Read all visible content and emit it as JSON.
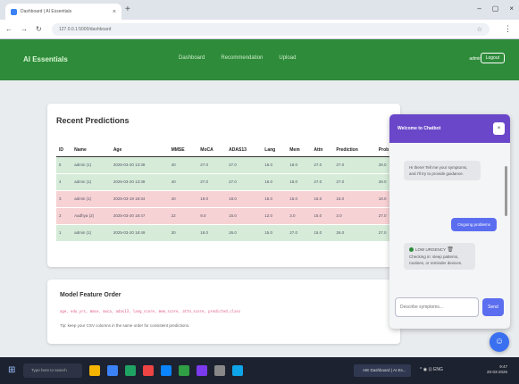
{
  "browser": {
    "tab_title": "Dashboard | AI Essentials",
    "url": "127.0.0.1:5000/dashboard",
    "close_glyph": "×",
    "new_tab_glyph": "+",
    "win_controls": [
      "–",
      "▢",
      "×"
    ],
    "nav_glyphs": [
      "←",
      "→",
      "↻"
    ],
    "star_glyph": "☆",
    "menu_glyph": "⋮"
  },
  "app": {
    "brand": "AI Essentials",
    "menu": [
      "Dashboard",
      "Recommendation",
      "Upload"
    ],
    "user": "admin",
    "logout": "Logout",
    "accent": "#2e8b3a"
  },
  "predictions": {
    "title": "Recent Predictions",
    "columns": [
      "ID",
      "Name",
      "Age",
      "MMSE",
      "MoCA",
      "ADAS13",
      "Lang",
      "Mem",
      "Attn",
      "Prediction",
      "Prob"
    ],
    "rows": [
      {
        "status": "green",
        "cells": [
          "5",
          "admin (1)",
          "2025-03-20 13:38",
          "40",
          "27.0",
          "27.0",
          "16.0",
          "18.0",
          "27.0",
          "27.0",
          "28.0"
        ]
      },
      {
        "status": "green",
        "cells": [
          "4",
          "admin (1)",
          "2025-03-20 13:38",
          "40",
          "27.0",
          "27.0",
          "16.0",
          "18.0",
          "27.0",
          "27.0",
          "28.0"
        ]
      },
      {
        "status": "red",
        "cells": [
          "3",
          "admin (1)",
          "2025-03-19 18:34",
          "40",
          "19.0",
          "18.0",
          "15.0",
          "15.0",
          "16.0",
          "15.0",
          "18.0"
        ]
      },
      {
        "status": "red",
        "cells": [
          "2",
          "Aadhya (2)",
          "2025-03-20 18:47",
          "22",
          "9.0",
          "15.0",
          "12.0",
          "3.0",
          "15.0",
          "3.0",
          "27.0"
        ]
      },
      {
        "status": "green",
        "cells": [
          "1",
          "admin (1)",
          "2025-03-20 18:49",
          "30",
          "18.0",
          "26.0",
          "15.0",
          "27.0",
          "15.0",
          "26.0",
          "27.0"
        ]
      }
    ]
  },
  "features": {
    "title": "Model Feature Order",
    "columns_text": "age, edu_yrs, mmse, moca, adas13, lang_score, mem_score, attn_score, predicted_class",
    "tip": "Tip: keep your CSV columns in the same order for consistent predictions."
  },
  "chat": {
    "title": "Welcome to Chatbot",
    "close": "×",
    "bot_msg_1": "Hi there! Tell me your symptoms, and I'll try to provide guidance.",
    "user_msg": "Ongoing problems",
    "bot_msg_2_label": "LOW URGENCY",
    "bot_msg_2_text": "Checking in: sleep patterns, routines, or reminder devices.",
    "trash_icon": "🗑",
    "input_placeholder": "Describe symptoms...",
    "send": "Send"
  },
  "fab_glyph": "☺",
  "taskbar": {
    "start_glyph": "⊞",
    "search": "Type here to search",
    "active_window": "AIE Dashboard | AI Es...",
    "tray": "^  ◉  ⊡  ENG",
    "time": "9:47",
    "date": "20-03-2025",
    "app_colors": [
      "#f5b400",
      "#3b82f6",
      "#1ea362",
      "#e44",
      "#0a84ff",
      "#2f9e44",
      "#7c3aed",
      "#888",
      "#0ea5e9"
    ]
  }
}
